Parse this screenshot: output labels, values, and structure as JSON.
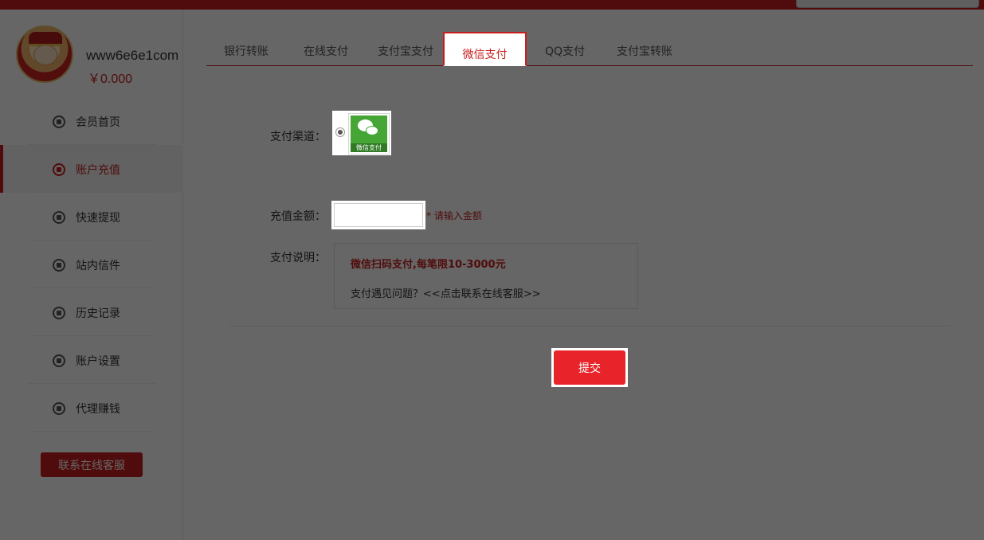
{
  "colors": {
    "accent": "#c81e1e",
    "submit": "#e8242a",
    "wechat_green": "#45a635"
  },
  "user": {
    "username": "www6e6e1com",
    "balance": "￥0.000"
  },
  "sidebar": {
    "items": [
      {
        "label": "会员首页",
        "icon": "home-icon"
      },
      {
        "label": "账户充值",
        "icon": "deposit-icon",
        "active": true
      },
      {
        "label": "快速提现",
        "icon": "withdraw-icon"
      },
      {
        "label": "站内信件",
        "icon": "mail-icon"
      },
      {
        "label": "历史记录",
        "icon": "history-icon"
      },
      {
        "label": "账户设置",
        "icon": "settings-icon"
      },
      {
        "label": "代理赚钱",
        "icon": "agent-icon"
      }
    ],
    "service_button": "联系在线客服"
  },
  "tabs": [
    {
      "label": "银行转账"
    },
    {
      "label": "在线支付"
    },
    {
      "label": "支付宝支付"
    },
    {
      "label": "微信支付",
      "active": true
    },
    {
      "label": "QQ支付"
    },
    {
      "label": "支付宝转账"
    }
  ],
  "form": {
    "channel_label": "支付渠道：",
    "channel_logo_text": "微信支付",
    "amount_label": "充值金额：",
    "amount_value": "",
    "amount_hint": "* 请输入金额",
    "desc_label": "支付说明：",
    "desc_limit": "微信扫码支付,每笔限10-3000元",
    "desc_contact": "支付遇见问题？<<点击联系在线客服>>",
    "submit_label": "提交"
  }
}
